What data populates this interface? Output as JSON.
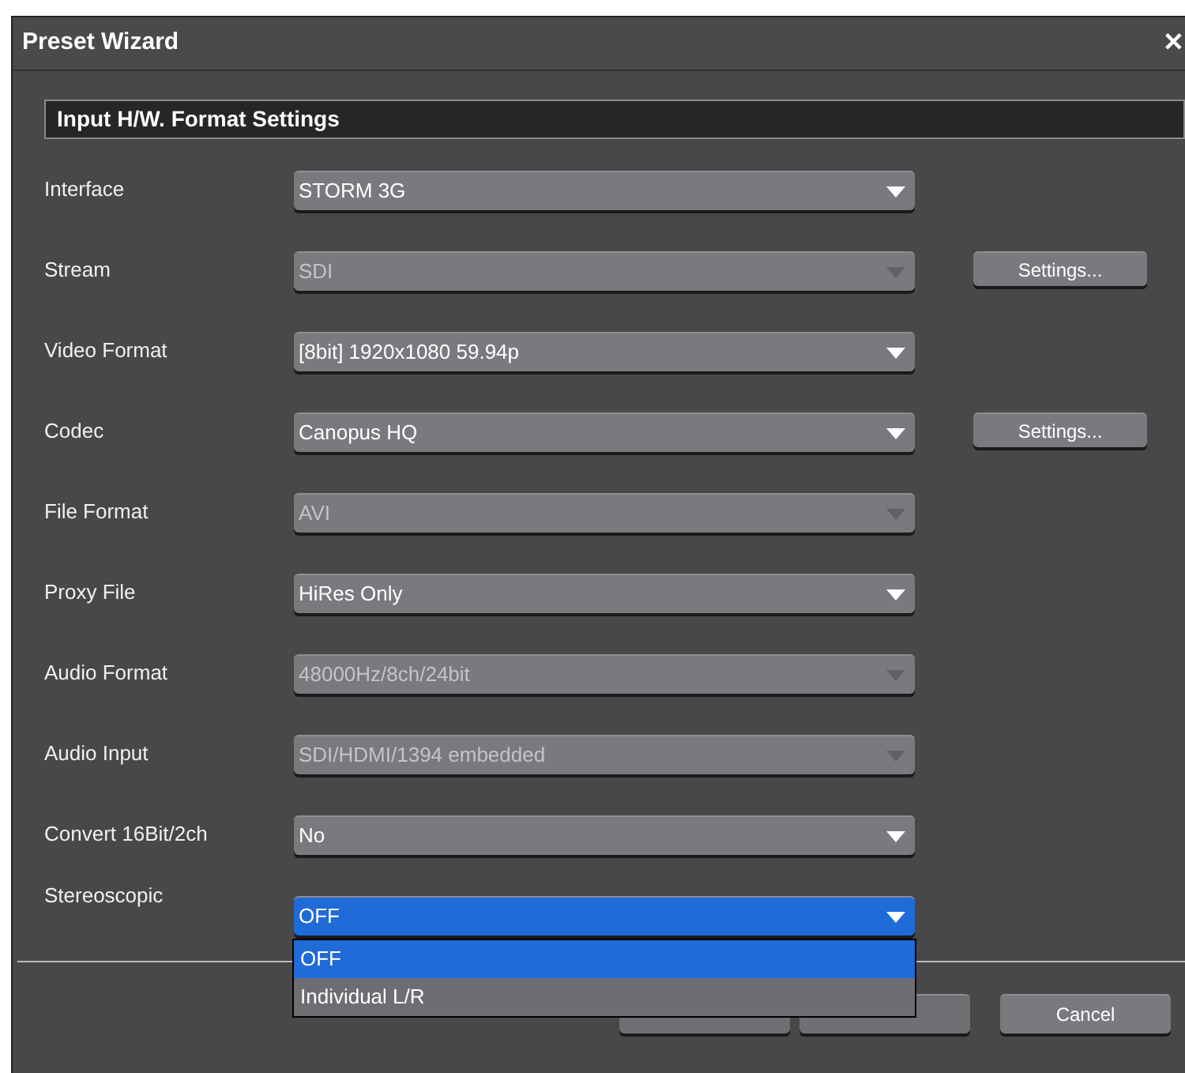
{
  "window": {
    "title": "Preset Wizard",
    "close": "✕"
  },
  "section_title": "Input H/W. Format Settings",
  "fields": [
    {
      "label": "Interface",
      "value": "STORM 3G",
      "disabled": false,
      "focused": false
    },
    {
      "label": "Stream",
      "value": "SDI",
      "disabled": true,
      "focused": false,
      "settings": "Settings..."
    },
    {
      "label": "Video Format",
      "value": "[8bit] 1920x1080 59.94p",
      "disabled": false,
      "focused": false
    },
    {
      "label": "Codec",
      "value": "Canopus HQ",
      "disabled": false,
      "focused": false,
      "settings": "Settings..."
    },
    {
      "label": "File Format",
      "value": "AVI",
      "disabled": true,
      "focused": false
    },
    {
      "label": "Proxy File",
      "value": "HiRes Only",
      "disabled": false,
      "focused": false
    },
    {
      "label": "Audio Format",
      "value": "48000Hz/8ch/24bit",
      "disabled": true,
      "focused": false
    },
    {
      "label": "Audio Input",
      "value": "SDI/HDMI/1394 embedded",
      "disabled": true,
      "focused": false
    },
    {
      "label": "Convert 16Bit/2ch",
      "value": "No",
      "disabled": false,
      "focused": false
    },
    {
      "label": "Stereoscopic",
      "value": "OFF",
      "disabled": false,
      "focused": true,
      "options": [
        {
          "label": "OFF",
          "selected": true
        },
        {
          "label": "Individual L/R",
          "selected": false
        }
      ]
    }
  ],
  "buttons": [
    {
      "label": "Cancel"
    }
  ]
}
